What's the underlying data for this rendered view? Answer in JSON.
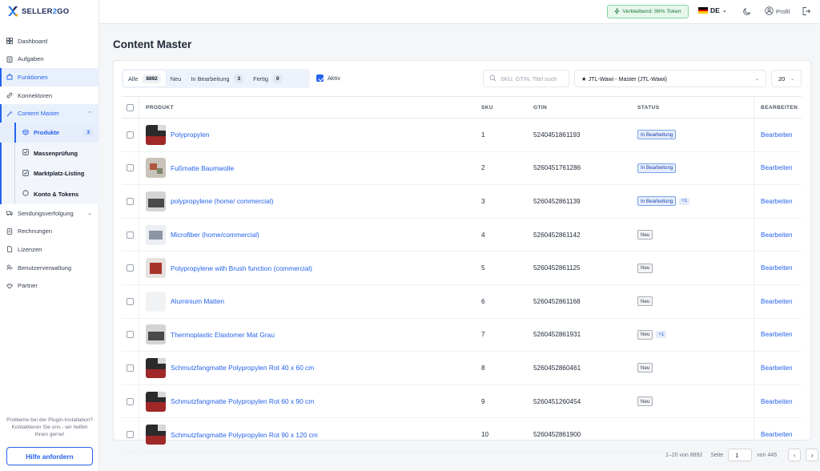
{
  "brand": {
    "name_a": "SELLER",
    "name_b": "2",
    "name_c": "GO",
    "colors": {
      "navy": "#1e2a5a",
      "blue": "#2b7de9",
      "accent": "#2563eb"
    }
  },
  "sidebar": {
    "items": [
      {
        "label": "Dashboard",
        "icon": "grid-icon"
      },
      {
        "label": "Aufgaben",
        "icon": "clipboard-icon"
      },
      {
        "label": "Funktionen",
        "icon": "puzzle-icon",
        "active": true
      },
      {
        "label": "Konnektoren",
        "icon": "link-icon"
      },
      {
        "label": "Content Master",
        "icon": "wand-icon",
        "expanded": true
      }
    ],
    "sub_items": [
      {
        "label": "Produkte",
        "icon": "box-icon",
        "badge": "3",
        "active": true
      },
      {
        "label": "Massenprüfung",
        "icon": "check-square-icon"
      },
      {
        "label": "Marktplatz-Listing",
        "icon": "check-square-icon"
      },
      {
        "label": "Konto & Tokens",
        "icon": "circle-icon"
      }
    ],
    "items_after": [
      {
        "label": "Sendungsverfolgung",
        "icon": "truck-icon",
        "has_chevron": true
      },
      {
        "label": "Rechnungen",
        "icon": "receipt-icon"
      },
      {
        "label": "Lizenzen",
        "icon": "document-icon"
      },
      {
        "label": "Benutzerverwaltung",
        "icon": "users-icon"
      },
      {
        "label": "Partner",
        "icon": "handshake-icon"
      }
    ],
    "help_text": "Probleme bei der Plugin-Installation? Kontaktieren Sie uns - wir helfen Ihnen gerne!",
    "help_button": "Hilfe anfordern"
  },
  "topbar": {
    "token_text": "Verbleibend: 98% Token",
    "language": "DE",
    "profile_label": "Profil"
  },
  "page": {
    "title": "Content Master"
  },
  "filters": {
    "tabs": [
      {
        "label": "Alle",
        "count": "8892",
        "active": true
      },
      {
        "label": "Neu",
        "count": ""
      },
      {
        "label": "In Bearbeitung",
        "count": "3"
      },
      {
        "label": "Fertig",
        "count": "0"
      }
    ],
    "aktiv_label": "Aktiv",
    "aktiv_checked": true,
    "search_placeholder": "SKU, GTIN, Titel such",
    "master_select": "★ JTL-Wawi - Master (JTL-Wawi)",
    "page_size": "20"
  },
  "table": {
    "headers": {
      "product": "PRODUKT",
      "sku": "SKU",
      "gtin": "GTIN",
      "status": "STATUS",
      "edit": "BEARBEITEN"
    },
    "edit_label": "Bearbeiten",
    "rows": [
      {
        "name": "Polypropylen",
        "sku": "1",
        "gtin": "5240451861193",
        "status": "In Bearbeitung",
        "status_kind": "progress",
        "extra": "",
        "thumb": "dark"
      },
      {
        "name": "Fußmatte Baumwolle",
        "sku": "2",
        "gtin": "5260451761286",
        "status": "In Bearbeitung",
        "status_kind": "progress",
        "extra": "",
        "thumb": "floral"
      },
      {
        "name": "polypropylene (home/ commercial)",
        "sku": "3",
        "gtin": "5260452861139",
        "status": "In Bearbeitung",
        "status_kind": "progress",
        "extra": "+1",
        "thumb": "gray"
      },
      {
        "name": "Microfiber (home/commercial)",
        "sku": "4",
        "gtin": "5260452861142",
        "status": "Neu",
        "status_kind": "neu",
        "extra": "",
        "thumb": "light"
      },
      {
        "name": "Polypropylene with Brush function (commercial)",
        "sku": "5",
        "gtin": "5260452861125",
        "status": "Neu",
        "status_kind": "neu",
        "extra": "",
        "thumb": "red"
      },
      {
        "name": "Aluminium Matten",
        "sku": "6",
        "gtin": "5260452861168",
        "status": "Neu",
        "status_kind": "neu",
        "extra": "",
        "thumb": "empty"
      },
      {
        "name": "Thermoplastic Elastomer Mat Grau",
        "sku": "7",
        "gtin": "5260452861931",
        "status": "Neu",
        "status_kind": "neu",
        "extra": "+1",
        "thumb": "gray"
      },
      {
        "name": "Schmutzfangmatte Polypropylen Rot 40 x 60 cm",
        "sku": "8",
        "gtin": "5260452860461",
        "status": "Neu",
        "status_kind": "neu",
        "extra": "",
        "thumb": "dark"
      },
      {
        "name": "Schmutzfangmatte Polypropylen Rot 60 x 90 cm",
        "sku": "9",
        "gtin": "5260451260454",
        "status": "Neu",
        "status_kind": "neu",
        "extra": "",
        "thumb": "dark"
      },
      {
        "name": "Schmutzfangmatte Polypropylen Rot 90 x 120 cm",
        "sku": "10",
        "gtin": "5260452861900",
        "status": "",
        "status_kind": "",
        "extra": "",
        "thumb": "dark"
      }
    ]
  },
  "pagination": {
    "range_text": "1–20 von 8892",
    "page_label": "Seite",
    "current_page": "1",
    "total_text": "von 445"
  }
}
